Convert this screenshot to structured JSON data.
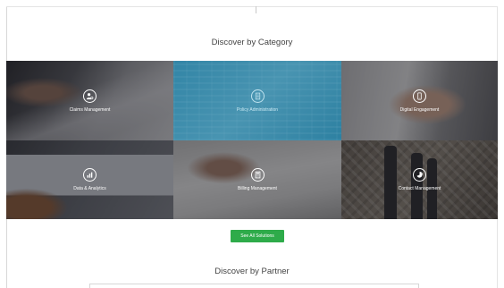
{
  "section_category": {
    "title": "Discover by Category",
    "tiles": [
      {
        "label": "Claims Management",
        "icon": "person-settings-icon",
        "active": false
      },
      {
        "label": "Policy Administration",
        "icon": "document-icon",
        "active": true
      },
      {
        "label": "Digital Engagement",
        "icon": "mobile-phone-icon",
        "active": false
      },
      {
        "label": "Data & Analytics",
        "icon": "bar-chart-icon",
        "active": false
      },
      {
        "label": "Billing Management",
        "icon": "calculator-icon",
        "active": false
      },
      {
        "label": "Contact Management",
        "icon": "contact-pie-icon",
        "active": false
      }
    ]
  },
  "see_all_button": {
    "label": "See All Solutions",
    "color": "#2eab4a"
  },
  "section_partner": {
    "title": "Discover by Partner"
  },
  "colors": {
    "accent_green": "#2eab4a",
    "active_overlay": "#1278a0",
    "heading_text": "#444444"
  }
}
